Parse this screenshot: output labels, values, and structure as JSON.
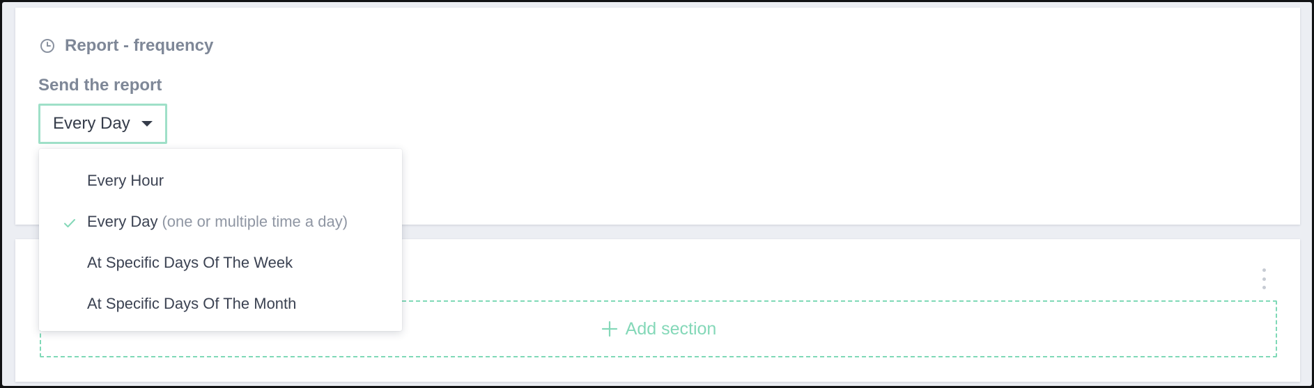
{
  "report": {
    "title": "Report - frequency",
    "subtitle": "Send the report",
    "frequency_select": {
      "selected": "Every Day"
    }
  },
  "dropdown": {
    "options": [
      {
        "label": "Every Hour",
        "note": "",
        "selected": false
      },
      {
        "label": "Every Day",
        "note": "(one or multiple time a day)",
        "selected": true
      },
      {
        "label": "At Specific Days Of The Week",
        "note": "",
        "selected": false
      },
      {
        "label": "At Specific Days Of The Month",
        "note": "",
        "selected": false
      }
    ]
  },
  "sections": {
    "add_label": "Add section"
  },
  "icons": {
    "title_icon": "clock-icon",
    "select_caret": "caret-down-icon",
    "selected_marker": "check-icon",
    "add_icon": "plus-icon",
    "menu_icon": "kebab-menu-icon"
  },
  "colors": {
    "accent": "#84d8b8",
    "select_border": "#9fe0c8",
    "heading": "#7e8797",
    "text": "#353c4a",
    "page_bg": "#eceef3"
  }
}
